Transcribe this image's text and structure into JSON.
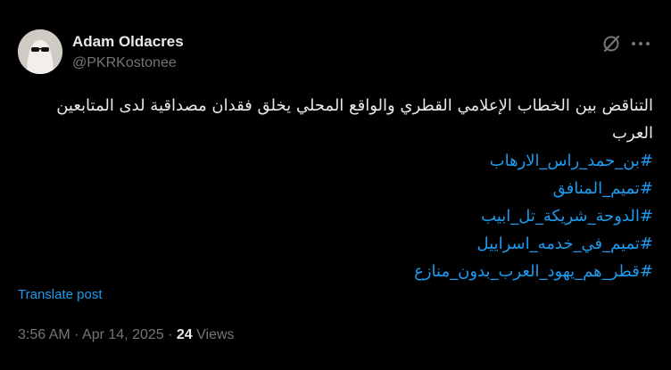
{
  "author": {
    "name": "Adam Oldacres",
    "handle": "@PKRKostonee"
  },
  "header_icons": [
    "grok-icon",
    "more-icon"
  ],
  "post": {
    "text": "التناقض بين الخطاب الإعلامي القطري والواقع المحلي يخلق فقدان مصداقية لدى المتابعين العرب",
    "hashtags": [
      "#بن_حمد_راس_الارهاب",
      "#تميم_المنافق",
      "#الدوحة_شريكة_تل_ابيب",
      "#تميم_في_خدمه_اسراييل",
      "#قطر_هم_يهود_العرب_بدون_منازع"
    ],
    "translate_label": "Translate post"
  },
  "meta": {
    "time": "3:56 AM",
    "separator": "·",
    "date": "Apr 14, 2025",
    "views_count": "24",
    "views_label": "Views"
  },
  "colors": {
    "background": "#000000",
    "text": "#e7e9ea",
    "secondary": "#71767b",
    "accent": "#1d9bf0"
  }
}
